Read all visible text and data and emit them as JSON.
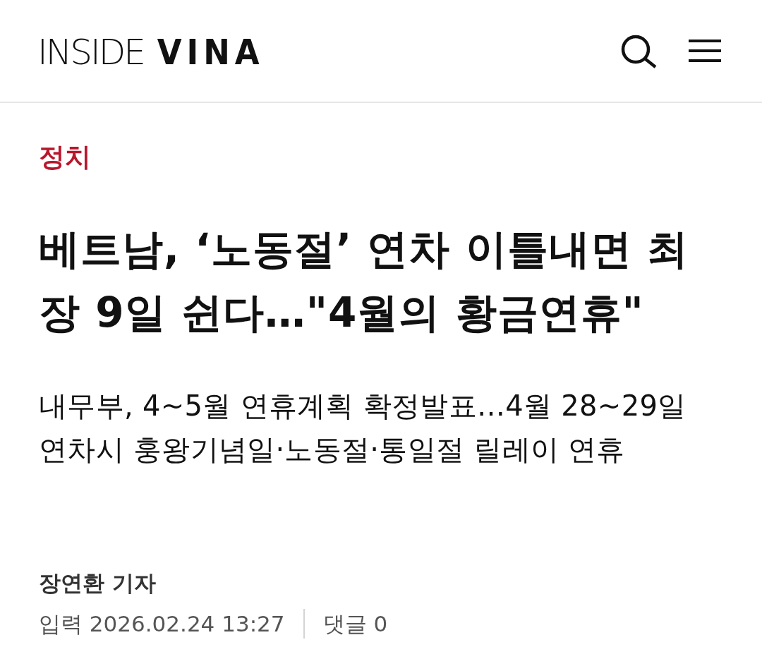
{
  "header": {
    "logo": "INSIDE **VINA**"
  },
  "article": {
    "category": "정치",
    "title": "베트남, ‘노동절’ 연차 이틀내면 최장 9일 쉰다…\"4월의 황금연휴\"",
    "subtitle": "내무부, 4~5월 연휴계획 확정발표…4월 28~29일 연차시 훙왕기념일·노동절·통일절 릴레이 연휴",
    "author": "장연환 기자",
    "published": "입력 2026.02.24 13:27",
    "comments": "댓글 0"
  }
}
